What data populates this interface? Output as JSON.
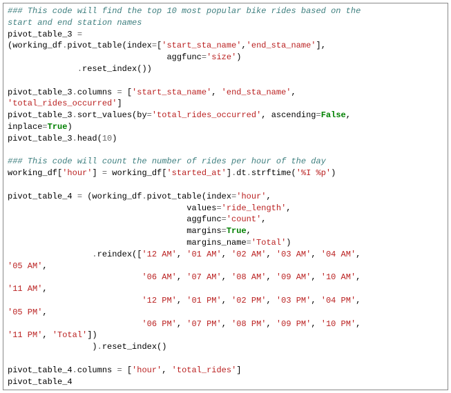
{
  "comment1": "### This code will find the top 10 most popular bike rides based on the\nstart and end station names",
  "line1a": "pivot_table_3 ",
  "line1b": "=",
  "line2a": "(working_df",
  "line2b": ".",
  "line2c": "pivot_table(index",
  "line2d": "=",
  "line2e": "[",
  "line2f": "'start_sta_name'",
  "line2g": ",",
  "line2h": "'end_sta_name'",
  "line2i": "],",
  "line3a": "                                aggfunc",
  "line3b": "=",
  "line3c": "'size'",
  "line3d": ")",
  "line4a": "              ",
  "line4b": ".",
  "line4c": "reset_index())",
  "blank1": "",
  "line5a": "pivot_table_3",
  "line5b": ".",
  "line5c": "columns ",
  "line5d": "=",
  "line5e": " [",
  "line5f": "'start_sta_name'",
  "line5g": ", ",
  "line5h": "'end_sta_name'",
  "line5i": ",",
  "line6a": "'total_rides_occurred'",
  "line6b": "]",
  "line7a": "pivot_table_3",
  "line7b": ".",
  "line7c": "sort_values(by",
  "line7d": "=",
  "line7e": "'total_rides_occurred'",
  "line7f": ", ascending",
  "line7g": "=",
  "line7h": "False",
  "line7i": ",",
  "line8a": "inplace",
  "line8b": "=",
  "line8c": "True",
  "line8d": ")",
  "line9a": "pivot_table_3",
  "line9b": ".",
  "line9c": "head(",
  "line9d": "10",
  "line9e": ")",
  "blank2": "",
  "comment2": "### This code will count the number of rides per hour of the day",
  "line10a": "working_df[",
  "line10b": "'hour'",
  "line10c": "] ",
  "line10d": "=",
  "line10e": " working_df[",
  "line10f": "'started_at'",
  "line10g": "]",
  "line10h": ".",
  "line10i": "dt",
  "line10j": ".",
  "line10k": "strftime(",
  "line10l": "'%I %p'",
  "line10m": ")",
  "blank3": "",
  "line11a": "pivot_table_4 ",
  "line11b": "=",
  "line11c": " (working_df",
  "line11d": ".",
  "line11e": "pivot_table(index",
  "line11f": "=",
  "line11g": "'hour'",
  "line11h": ",",
  "line12a": "                                    values",
  "line12b": "=",
  "line12c": "'ride_length'",
  "line12d": ",",
  "line13a": "                                    aggfunc",
  "line13b": "=",
  "line13c": "'count'",
  "line13d": ",",
  "line14a": "                                    margins",
  "line14b": "=",
  "line14c": "True",
  "line14d": ",",
  "line15a": "                                    margins_name",
  "line15b": "=",
  "line15c": "'Total'",
  "line15d": ")",
  "line16a": "                 ",
  "line16b": ".",
  "line16c": "reindex([",
  "line16d": "'12 AM'",
  "line16e": ", ",
  "line16f": "'01 AM'",
  "line16g": ", ",
  "line16h": "'02 AM'",
  "line16i": ", ",
  "line16j": "'03 AM'",
  "line16k": ", ",
  "line16l": "'04 AM'",
  "line16m": ",",
  "line17a": "'05 AM'",
  "line17b": ",",
  "line18a": "                           ",
  "line18b": "'06 AM'",
  "line18c": ", ",
  "line18d": "'07 AM'",
  "line18e": ", ",
  "line18f": "'08 AM'",
  "line18g": ", ",
  "line18h": "'09 AM'",
  "line18i": ", ",
  "line18j": "'10 AM'",
  "line18k": ",",
  "line19a": "'11 AM'",
  "line19b": ",",
  "line20a": "                           ",
  "line20b": "'12 PM'",
  "line20c": ", ",
  "line20d": "'01 PM'",
  "line20e": ", ",
  "line20f": "'02 PM'",
  "line20g": ", ",
  "line20h": "'03 PM'",
  "line20i": ", ",
  "line20j": "'04 PM'",
  "line20k": ",",
  "line21a": "'05 PM'",
  "line21b": ",",
  "line22a": "                           ",
  "line22b": "'06 PM'",
  "line22c": ", ",
  "line22d": "'07 PM'",
  "line22e": ", ",
  "line22f": "'08 PM'",
  "line22g": ", ",
  "line22h": "'09 PM'",
  "line22i": ", ",
  "line22j": "'10 PM'",
  "line22k": ",",
  "line23a": "'11 PM'",
  "line23b": ", ",
  "line23c": "'Total'",
  "line23d": "])",
  "line24a": "                 )",
  "line24b": ".",
  "line24c": "reset_index()",
  "blank4": "",
  "line25a": "pivot_table_4",
  "line25b": ".",
  "line25c": "columns ",
  "line25d": "=",
  "line25e": " [",
  "line25f": "'hour'",
  "line25g": ", ",
  "line25h": "'total_rides'",
  "line25i": "]",
  "line26a": "pivot_table_4"
}
